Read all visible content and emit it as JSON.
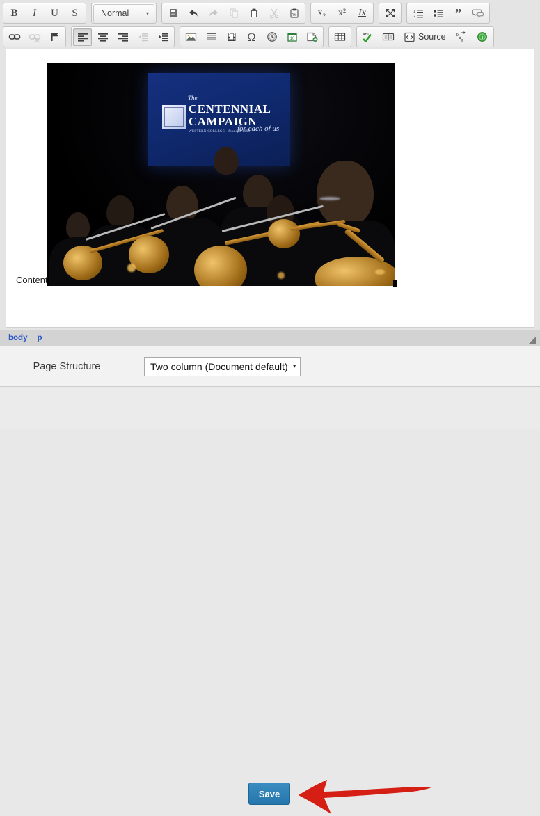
{
  "editor": {
    "toolbar_row1": [
      {
        "name": "bold",
        "label": "B",
        "title": "Bold",
        "state": "normal"
      },
      {
        "name": "italic",
        "label": "I",
        "title": "Italic",
        "state": "normal"
      },
      {
        "name": "underline",
        "label": "U",
        "title": "Underline",
        "state": "normal"
      },
      {
        "name": "strikethrough",
        "label": "S",
        "title": "Strike Through",
        "state": "normal"
      },
      {
        "name": "paragraph-format",
        "label": "Normal",
        "title": "Paragraph Format",
        "state": "normal"
      },
      {
        "name": "templates",
        "label": "",
        "title": "Templates",
        "state": "normal"
      },
      {
        "name": "undo",
        "label": "",
        "title": "Undo",
        "state": "normal"
      },
      {
        "name": "redo",
        "label": "",
        "title": "Redo",
        "state": "disabled"
      },
      {
        "name": "copy",
        "label": "",
        "title": "Copy",
        "state": "disabled"
      },
      {
        "name": "paste",
        "label": "",
        "title": "Paste",
        "state": "normal"
      },
      {
        "name": "cut",
        "label": "",
        "title": "Cut",
        "state": "disabled"
      },
      {
        "name": "paste-from-word",
        "label": "",
        "title": "Paste from Word",
        "state": "normal"
      },
      {
        "name": "subscript",
        "label": "x₂",
        "title": "Subscript",
        "state": "normal"
      },
      {
        "name": "superscript",
        "label": "x²",
        "title": "Superscript",
        "state": "normal"
      },
      {
        "name": "remove-format",
        "label": "Ix",
        "title": "Remove Format",
        "state": "normal"
      },
      {
        "name": "maximize",
        "label": "",
        "title": "Maximize",
        "state": "normal"
      },
      {
        "name": "numbered-list",
        "label": "",
        "title": "Insert/Remove Numbered List",
        "state": "normal"
      },
      {
        "name": "bulleted-list",
        "label": "",
        "title": "Insert/Remove Bulleted List",
        "state": "normal"
      },
      {
        "name": "blockquote",
        "label": "",
        "title": "Block Quote",
        "state": "normal"
      },
      {
        "name": "comment",
        "label": "",
        "title": "Comment",
        "state": "normal"
      }
    ],
    "toolbar_row2": [
      {
        "name": "link",
        "label": "",
        "title": "Link",
        "state": "normal"
      },
      {
        "name": "unlink",
        "label": "",
        "title": "Unlink",
        "state": "disabled"
      },
      {
        "name": "anchor",
        "label": "",
        "title": "Anchor",
        "state": "normal"
      },
      {
        "name": "align-left",
        "label": "",
        "title": "Align Left",
        "state": "active"
      },
      {
        "name": "align-center",
        "label": "",
        "title": "Center",
        "state": "normal"
      },
      {
        "name": "align-right",
        "label": "",
        "title": "Align Right",
        "state": "normal"
      },
      {
        "name": "decrease-indent",
        "label": "",
        "title": "Decrease Indent",
        "state": "disabled"
      },
      {
        "name": "increase-indent",
        "label": "",
        "title": "Increase Indent",
        "state": "normal"
      },
      {
        "name": "image",
        "label": "",
        "title": "Image",
        "state": "normal"
      },
      {
        "name": "horizontal-rule",
        "label": "",
        "title": "Horizontal Line",
        "state": "normal"
      },
      {
        "name": "media",
        "label": "",
        "title": "Media Embed",
        "state": "normal"
      },
      {
        "name": "special-character",
        "label": "Ω",
        "title": "Insert Special Character",
        "state": "normal"
      },
      {
        "name": "clock",
        "label": "",
        "title": "Insert Time",
        "state": "normal"
      },
      {
        "name": "calendar",
        "label": "10",
        "title": "Insert Date",
        "state": "normal"
      },
      {
        "name": "page-break",
        "label": "",
        "title": "Page Break",
        "state": "normal"
      },
      {
        "name": "table",
        "label": "",
        "title": "Table",
        "state": "normal"
      },
      {
        "name": "spell-check",
        "label": "ABC",
        "title": "Check Spelling",
        "state": "normal"
      },
      {
        "name": "glossary",
        "label": "",
        "title": "Glossary",
        "state": "normal"
      },
      {
        "name": "source",
        "label": "Source",
        "title": "Source",
        "state": "normal"
      },
      {
        "name": "text-replace",
        "label": "",
        "title": "Find and Replace",
        "state": "normal"
      },
      {
        "name": "about",
        "label": "i",
        "title": "About CKEditor",
        "state": "normal"
      }
    ],
    "paragraph_format": {
      "value": "Normal",
      "caret": "▾"
    },
    "source_button_label": "Source",
    "content": {
      "text": "Content",
      "image": {
        "alt": "Brass section of a concert band performing in front of a projection screen",
        "screen": {
          "the": "The",
          "line1": "CENTENNIAL",
          "line2": "CAMPAIGN",
          "tagline": "WESTERN COLLEGE · founded 1909",
          "script": "for each of us"
        },
        "selected": true
      }
    },
    "status_bar": {
      "elements": [
        "body",
        "p"
      ]
    }
  },
  "page_structure": {
    "label": "Page Structure",
    "select_value": "Two column (Document default)",
    "caret": "▾"
  },
  "footer": {
    "save_label": "Save",
    "annotation": "red-arrow-pointing-at-save"
  },
  "colors": {
    "accent_blue": "#2476ac",
    "annotation_red": "#d61f14",
    "path_link": "#2a56c6",
    "chrome": "#e4e4e4"
  }
}
